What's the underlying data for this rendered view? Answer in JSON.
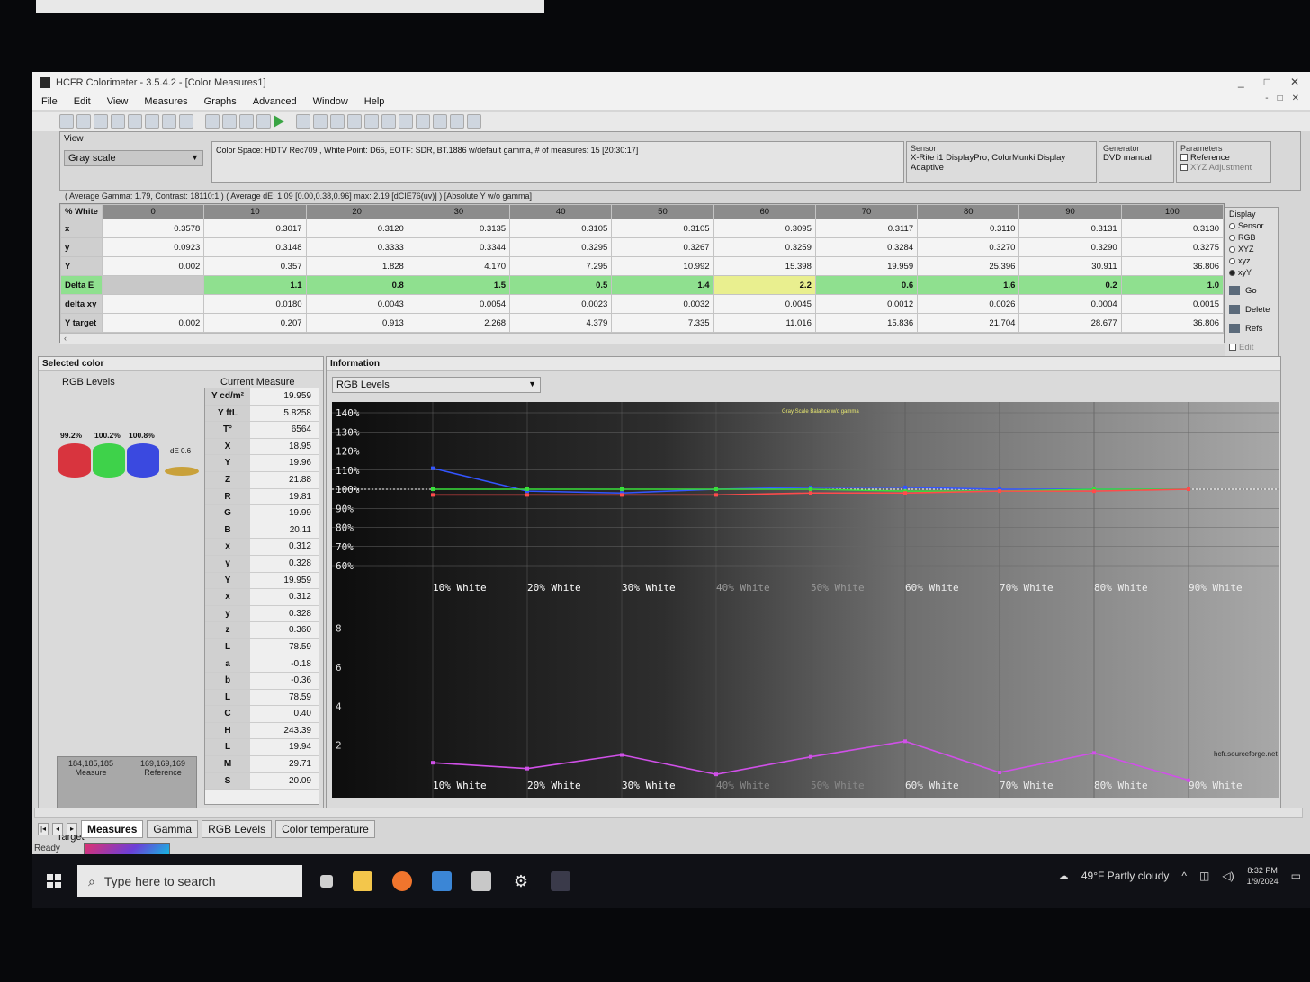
{
  "window": {
    "title": "HCFR Colorimeter - 3.5.4.2 - [Color Measures1]",
    "controls": [
      "_",
      "□",
      "✕"
    ],
    "mdi_controls": [
      "-",
      "□",
      "✕"
    ]
  },
  "menu": [
    "File",
    "Edit",
    "View",
    "Measures",
    "Graphs",
    "Advanced",
    "Window",
    "Help"
  ],
  "view": {
    "label": "View",
    "selected": "Gray scale",
    "colorspace_line": "Color Space: HDTV Rec709 , White Point: D65, EOTF:  SDR, BT.1886 w/default gamma, # of measures: 15 [20:30:17]"
  },
  "sensor": {
    "title": "Sensor",
    "name": "X-Rite i1 DisplayPro, ColorMunki Display",
    "mode": "Adaptive"
  },
  "generator": {
    "title": "Generator",
    "name": "DVD manual"
  },
  "parameters": {
    "title": "Parameters",
    "reference": "Reference",
    "xyz_adjustment": "XYZ Adjustment"
  },
  "stats_line": "( Average Gamma: 1.79, Contrast: 18110:1 ) ( Average dE: 1.09 [0.00,0.38,0.96] max: 2.19 [dCIE76(uv)] ) [Absolute Y w/o gamma]",
  "measures": {
    "corner": "% White",
    "columns": [
      "0",
      "10",
      "20",
      "30",
      "40",
      "50",
      "60",
      "70",
      "80",
      "90",
      "100"
    ],
    "rows": [
      {
        "label": "x",
        "values": [
          "0.3578",
          "0.3017",
          "0.3120",
          "0.3135",
          "0.3105",
          "0.3105",
          "0.3095",
          "0.3117",
          "0.3110",
          "0.3131",
          "0.3130"
        ]
      },
      {
        "label": "y",
        "values": [
          "0.0923",
          "0.3148",
          "0.3333",
          "0.3344",
          "0.3295",
          "0.3267",
          "0.3259",
          "0.3284",
          "0.3270",
          "0.3290",
          "0.3275"
        ]
      },
      {
        "label": "Y",
        "values": [
          "0.002",
          "0.357",
          "1.828",
          "4.170",
          "7.295",
          "10.992",
          "15.398",
          "19.959",
          "25.396",
          "30.911",
          "36.806"
        ]
      },
      {
        "label": "Delta E",
        "values": [
          "",
          "1.1",
          "0.8",
          "1.5",
          "0.5",
          "1.4",
          "2.2",
          "0.6",
          "1.6",
          "0.2",
          "1.0"
        ]
      },
      {
        "label": "delta xy",
        "values": [
          "",
          "0.0180",
          "0.0043",
          "0.0054",
          "0.0023",
          "0.0032",
          "0.0045",
          "0.0012",
          "0.0026",
          "0.0004",
          "0.0015"
        ]
      },
      {
        "label": "Y target",
        "values": [
          "0.002",
          "0.207",
          "0.913",
          "2.268",
          "4.379",
          "7.335",
          "11.016",
          "15.836",
          "21.704",
          "28.677",
          "36.806"
        ]
      }
    ]
  },
  "display_panel": {
    "title": "Display",
    "options": [
      "Sensor",
      "RGB",
      "XYZ",
      "xyz",
      "xyY"
    ],
    "selected": "xyY",
    "buttons": [
      "Go",
      "Delete",
      "Refs"
    ],
    "edit": "Edit"
  },
  "selected_color": {
    "title": "Selected color",
    "rgb_title": "RGB Levels",
    "current_title": "Current Measure",
    "bars": [
      {
        "label": "99.2%",
        "color": "#d8343e",
        "value": 0.992
      },
      {
        "label": "100.2%",
        "color": "#3ed24a",
        "value": 1.002
      },
      {
        "label": "100.8%",
        "color": "#3a49e0",
        "value": 1.008
      }
    ],
    "de": "dE 0.6",
    "measure_val": "184,185,185",
    "measure_lbl": "Measure",
    "reference_val": "169,169,169",
    "reference_lbl": "Reference",
    "target_lbl": "Target",
    "current_measure": [
      [
        "Y cd/m²",
        "19.959"
      ],
      [
        "Y ftL",
        "5.8258"
      ],
      [
        "T°",
        "6564"
      ],
      [
        "X",
        "18.95"
      ],
      [
        "Y",
        "19.96"
      ],
      [
        "Z",
        "21.88"
      ],
      [
        "R",
        "19.81"
      ],
      [
        "G",
        "19.99"
      ],
      [
        "B",
        "20.11"
      ],
      [
        "x",
        "0.312"
      ],
      [
        "y",
        "0.328"
      ],
      [
        "Y",
        "19.959"
      ],
      [
        "x",
        "0.312"
      ],
      [
        "y",
        "0.328"
      ],
      [
        "z",
        "0.360"
      ],
      [
        "L",
        "78.59"
      ],
      [
        "a",
        "-0.18"
      ],
      [
        "b",
        "-0.36"
      ],
      [
        "L",
        "78.59"
      ],
      [
        "C",
        "0.40"
      ],
      [
        "H",
        "243.39"
      ],
      [
        "L",
        "19.94"
      ],
      [
        "M",
        "29.71"
      ],
      [
        "S",
        "20.09"
      ]
    ]
  },
  "information": {
    "title": "Information",
    "selected": "RGB Levels",
    "plot_title": "Gray Scale Balance w/o gamma",
    "watermark": "hcfr.sourceforge.net"
  },
  "chart_data": [
    {
      "type": "line",
      "title": "Gray Scale Balance w/o gamma",
      "ytick_labels": [
        "140%",
        "130%",
        "120%",
        "110%",
        "100%",
        "90%",
        "80%",
        "70%",
        "60%"
      ],
      "categories": [
        "10% White",
        "20% White",
        "30% White",
        "40% White",
        "50% White",
        "60% White",
        "70% White",
        "80% White",
        "90% White"
      ],
      "ylim": [
        60,
        140
      ],
      "series": [
        {
          "color": "#3355ff",
          "values": [
            111,
            99,
            98,
            100,
            101,
            101,
            100,
            100,
            100
          ]
        },
        {
          "color": "#39e03a",
          "values": [
            100,
            100,
            100,
            100,
            100,
            99,
            99,
            100,
            100
          ]
        },
        {
          "color": "#ff4b4b",
          "values": [
            97,
            97,
            97,
            97,
            98,
            98,
            99,
            99,
            100
          ]
        }
      ]
    },
    {
      "type": "line",
      "ytick_labels": [
        "8",
        "6",
        "4",
        "2"
      ],
      "categories": [
        "10% White",
        "20% White",
        "30% White",
        "40% White",
        "50% White",
        "60% White",
        "70% White",
        "80% White",
        "90% White"
      ],
      "ylim": [
        0,
        9
      ],
      "series": [
        {
          "color": "#d050e8",
          "values": [
            1.1,
            0.8,
            1.5,
            0.5,
            1.4,
            2.2,
            0.6,
            1.6,
            0.2
          ]
        }
      ]
    }
  ],
  "tabs": [
    "Measures",
    "Gamma",
    "RGB Levels",
    "Color temperature"
  ],
  "active_tab": "Measures",
  "status": "Ready",
  "taskbar": {
    "search_placeholder": "Type here to search",
    "weather": "49°F  Partly cloudy",
    "time": "8:32 PM",
    "date": "1/9/2024"
  }
}
